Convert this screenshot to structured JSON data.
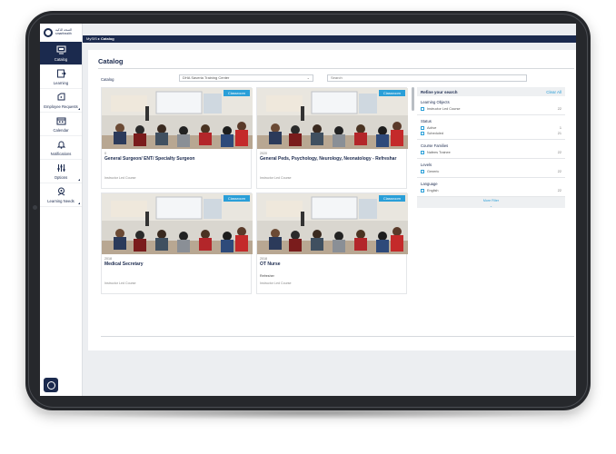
{
  "sidebar": {
    "logo_line1": "الصحة الذكية",
    "logo_line2": "smarthealth",
    "items": [
      {
        "label": "Catalog",
        "icon": "catalog-icon"
      },
      {
        "label": "Learning",
        "icon": "learning-icon"
      },
      {
        "label": "Employee Requests",
        "icon": "requests-icon"
      },
      {
        "label": "Calendar",
        "icon": "calendar-icon"
      },
      {
        "label": "Notifications",
        "icon": "bell-icon"
      },
      {
        "label": "Options",
        "icon": "options-icon"
      },
      {
        "label": "Learning Needs",
        "icon": "learning-needs-icon"
      }
    ]
  },
  "breadcrumb": {
    "root": "MySIS",
    "separator": "▸",
    "current": "Catalog"
  },
  "page": {
    "title": "Catalog",
    "filter_label": "Catalog",
    "training_center": "DHA Saveria Training Center",
    "search_value": "Search"
  },
  "courses": [
    {
      "badge": "Classroom",
      "year": "0",
      "title": "General Surgeon/ ENT/ Specialty Surgeon",
      "subtitle": "",
      "type": "Instructor Led Course"
    },
    {
      "badge": "Classroom",
      "year": "2020",
      "title": "General Peds, Psychology, Neurology, Neonatology - Refreshar",
      "subtitle": "",
      "type": "Instructor Led Course"
    },
    {
      "badge": "Classroom",
      "year": "2018",
      "title": "Medical Secretary",
      "subtitle": "",
      "type": "Instructor Led Course"
    },
    {
      "badge": "Classroom",
      "year": "2018",
      "title": "OT Nurse",
      "subtitle": "Refresher",
      "type": "Instructor Led Course"
    }
  ],
  "refine": {
    "title": "Refine your search",
    "clear": "Clear All",
    "sections": [
      {
        "title": "Learning Objects",
        "options": [
          {
            "label": "Instructor Led Course",
            "count": "22"
          }
        ]
      },
      {
        "title": "Status",
        "options": [
          {
            "label": "Active",
            "count": "1"
          },
          {
            "label": "Scheduled",
            "count": "21"
          }
        ]
      },
      {
        "title": "Course Families",
        "options": [
          {
            "label": "Nafees Trainee",
            "count": "22"
          }
        ]
      },
      {
        "title": "Levels",
        "options": [
          {
            "label": "Generic",
            "count": "22"
          }
        ]
      },
      {
        "title": "Language",
        "options": [
          {
            "label": "English",
            "count": "22"
          }
        ]
      }
    ],
    "more_filter": "More Filter",
    "more_filter_chevron": "⌄"
  },
  "colors": {
    "navy": "#1b2a4e",
    "accent": "#2a9fd8"
  }
}
